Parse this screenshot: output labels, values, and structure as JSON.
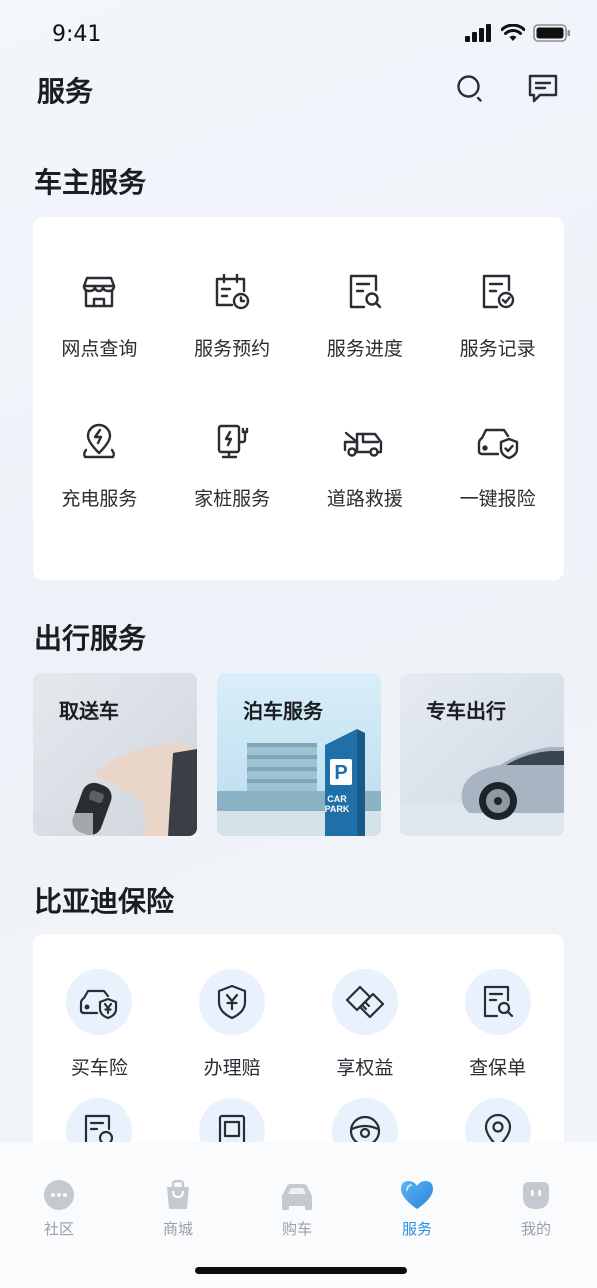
{
  "status_bar": {
    "time": "9:41"
  },
  "header": {
    "title": "服务"
  },
  "owner_services": {
    "title": "车主服务",
    "items": [
      {
        "label": "网点查询",
        "icon": "store-icon"
      },
      {
        "label": "服务预约",
        "icon": "calendar-clock-icon"
      },
      {
        "label": "服务进度",
        "icon": "document-search-icon"
      },
      {
        "label": "服务记录",
        "icon": "document-check-icon"
      },
      {
        "label": "充电服务",
        "icon": "charging-pin-icon"
      },
      {
        "label": "家桩服务",
        "icon": "home-charger-icon"
      },
      {
        "label": "道路救援",
        "icon": "tow-truck-icon"
      },
      {
        "label": "一键报险",
        "icon": "car-shield-icon"
      }
    ]
  },
  "travel_services": {
    "title": "出行服务",
    "items": [
      {
        "label": "取送车"
      },
      {
        "label": "泊车服务",
        "sign": "CAR PARK"
      },
      {
        "label": "专车出行"
      }
    ]
  },
  "insurance": {
    "title": "比亚迪保险",
    "items": [
      {
        "label": "买车险",
        "icon": "car-yen-icon"
      },
      {
        "label": "办理赔",
        "icon": "shield-yen-icon"
      },
      {
        "label": "享权益",
        "icon": "handshake-icon"
      },
      {
        "label": "查保单",
        "icon": "document-search-icon"
      }
    ]
  },
  "tabbar": {
    "tabs": [
      {
        "label": "社区",
        "active": false
      },
      {
        "label": "商城",
        "active": false
      },
      {
        "label": "购车",
        "active": false
      },
      {
        "label": "服务",
        "active": true
      },
      {
        "label": "我的",
        "active": false
      }
    ]
  },
  "colors": {
    "accent": "#2f8ee0",
    "inactive": "#9aa0a8",
    "icon_bg": "#e8f1fc"
  }
}
